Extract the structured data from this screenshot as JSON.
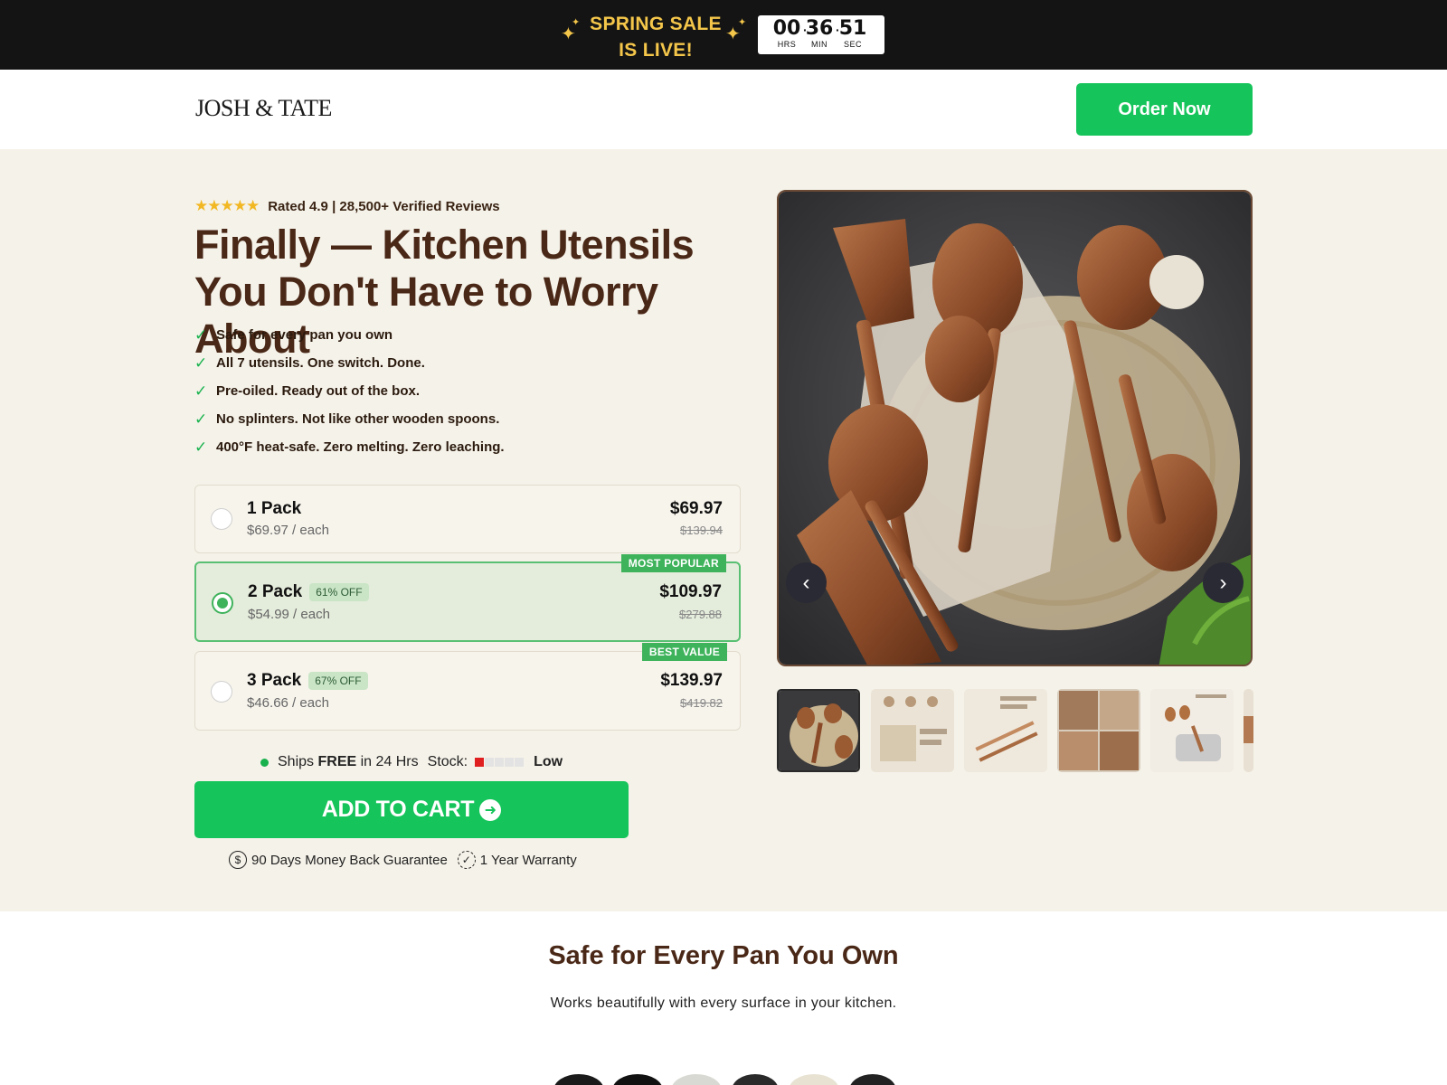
{
  "banner": {
    "sale_line1": "SPRING SALE",
    "sale_line2": "IS LIVE!",
    "sparkle_icon": "sparkle-icon",
    "timer": {
      "hours": "00",
      "minutes": "36",
      "seconds": "51",
      "hours_label": "HRS",
      "minutes_label": "MIN",
      "seconds_label": "SEC"
    }
  },
  "header": {
    "logo": "JOSH & TATE",
    "order_button": "Order Now"
  },
  "hero": {
    "stars": "★★★★★",
    "rating_text": "Rated 4.9 | 28,500+ Verified Reviews",
    "headline": "Finally — Kitchen Utensils You Don't Have to Worry About",
    "benefits": [
      "Safe for every pan you own",
      "All 7 utensils. One switch. Done.",
      "Pre-oiled. Ready out of the box.",
      "No splinters. Not like other wooden spoons.",
      "400°F heat-safe. Zero melting. Zero leaching."
    ],
    "packs": [
      {
        "name": "1 Pack",
        "each": "$69.97 / each",
        "price": "$69.97",
        "old_price": "$139.94",
        "badge": "",
        "ribbon": "",
        "selected": false
      },
      {
        "name": "2 Pack",
        "each": "$54.99 / each",
        "price": "$109.97",
        "old_price": "$279.88",
        "badge": "61% OFF",
        "ribbon": "MOST POPULAR",
        "selected": true
      },
      {
        "name": "3 Pack",
        "each": "$46.66 / each",
        "price": "$139.97",
        "old_price": "$419.82",
        "badge": "67% OFF",
        "ribbon": "BEST VALUE",
        "selected": false
      }
    ],
    "shipping": {
      "ships": "Ships",
      "free": "FREE",
      "in": "in 24 Hrs",
      "stock_label": "Stock:",
      "stock_level": "Low",
      "stock_fraction": 0.2
    },
    "add_to_cart": "ADD TO CART",
    "guarantee": "90 Days Money Back Guarantee",
    "warranty": "1 Year Warranty",
    "gallery": {
      "thumbnail_count_visible": 6,
      "prev_icon": "chevron-left-icon",
      "next_icon": "chevron-right-icon"
    }
  },
  "section2": {
    "title": "Safe for Every Pan You Own",
    "subtitle": "Works beautifully with every surface in your kitchen."
  },
  "colors": {
    "banner_bg": "#141414",
    "sale_gold": "#f4c64a",
    "cta_green": "#15c45a",
    "hero_bg": "#f5f2e9",
    "headline_brown": "#4a2817",
    "selected_border": "#58c072"
  }
}
